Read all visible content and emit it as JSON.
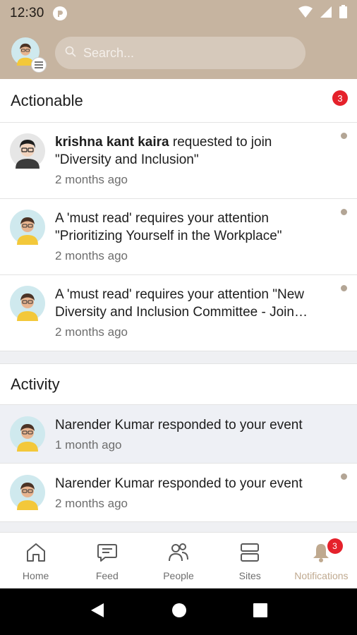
{
  "status_bar": {
    "time": "12:30"
  },
  "search": {
    "placeholder": "Search..."
  },
  "actionable": {
    "title": "Actionable",
    "count": "3",
    "items": [
      {
        "actor": "krishna kant kaira",
        "text": " requested to join \"Diversity and Inclusion\"",
        "time": "2 months ago"
      },
      {
        "text": "A 'must read' requires your attention \"Prioritizing Yourself in the Workplace\"",
        "time": "2 months ago"
      },
      {
        "text_line1": "A 'must read' requires your attention \"New",
        "text_line2": "Diversity and Inclusion Committee - Join…",
        "time": "2 months ago"
      }
    ]
  },
  "activity": {
    "title": "Activity",
    "items": [
      {
        "text": "Narender Kumar responded to your event",
        "time": "1 month ago"
      },
      {
        "text": "Narender Kumar responded to your event",
        "time": "2 months ago"
      }
    ]
  },
  "bottom_nav": {
    "home": "Home",
    "feed": "Feed",
    "people": "People",
    "sites": "Sites",
    "notifications": "Notifications",
    "notifications_badge": "3"
  },
  "colors": {
    "header": "#c6b4a0",
    "accent": "#bfa98f",
    "badge": "#e5212b"
  },
  "icons": [
    "wifi-icon",
    "signal-icon",
    "battery-icon",
    "search-icon",
    "menu-icon",
    "home-icon",
    "feed-icon",
    "people-icon",
    "sites-icon",
    "bell-icon",
    "back-icon",
    "home-circle-icon",
    "recents-icon"
  ]
}
